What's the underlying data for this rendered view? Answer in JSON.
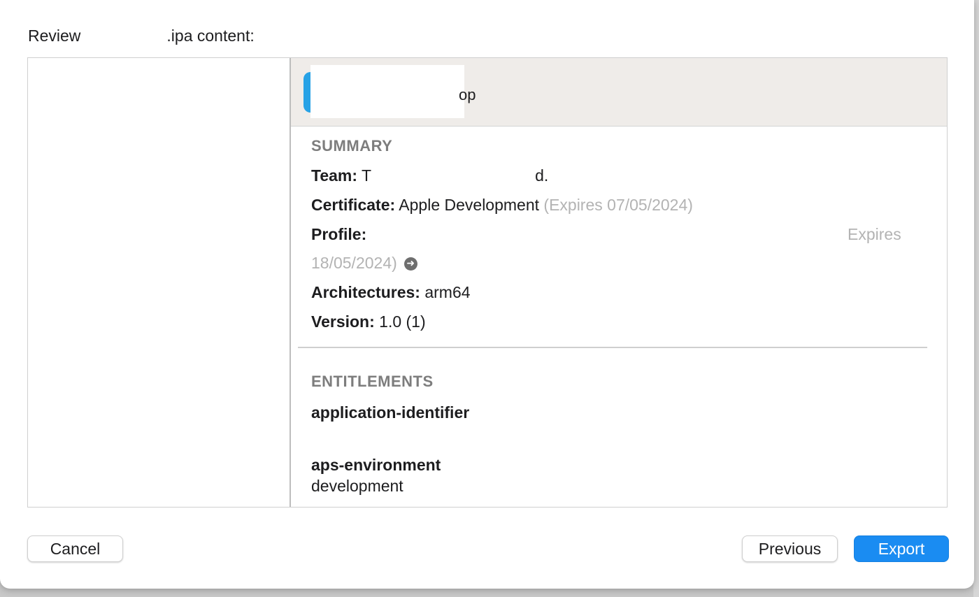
{
  "dialog": {
    "title_prefix": "Review",
    "title_suffix": ".ipa content:"
  },
  "sidebar": {
    "items": [
      {
        "label": ""
      }
    ]
  },
  "app": {
    "name_fragment": "op",
    "icon_color": "#27a2e6"
  },
  "summary": {
    "heading": "SUMMARY",
    "team_label": "Team:",
    "team_value_start": "T",
    "team_value_end": "d.",
    "certificate_label": "Certificate:",
    "certificate_value": "Apple Development",
    "certificate_expiry": "(Expires 07/05/2024)",
    "profile_label": "Profile:",
    "profile_expiry_start": "Expires",
    "profile_expiry_end": "18/05/2024)",
    "profile_arrow_icon": "arrow-right-circle-icon",
    "architectures_label": "Architectures:",
    "architectures_value": "arm64",
    "version_label": "Version:",
    "version_value": "1.0 (1)"
  },
  "entitlements": {
    "heading": "ENTITLEMENTS",
    "items": [
      {
        "key": "application-identifier",
        "value": ""
      },
      {
        "key": "aps-environment",
        "value": "development"
      }
    ]
  },
  "buttons": {
    "cancel": "Cancel",
    "previous": "Previous",
    "export": "Export"
  },
  "colors": {
    "accent": "#1a8cf2",
    "header_bg": "#efece9",
    "section_heading": "#7d7d7d",
    "muted_text": "#b3b3b3"
  }
}
